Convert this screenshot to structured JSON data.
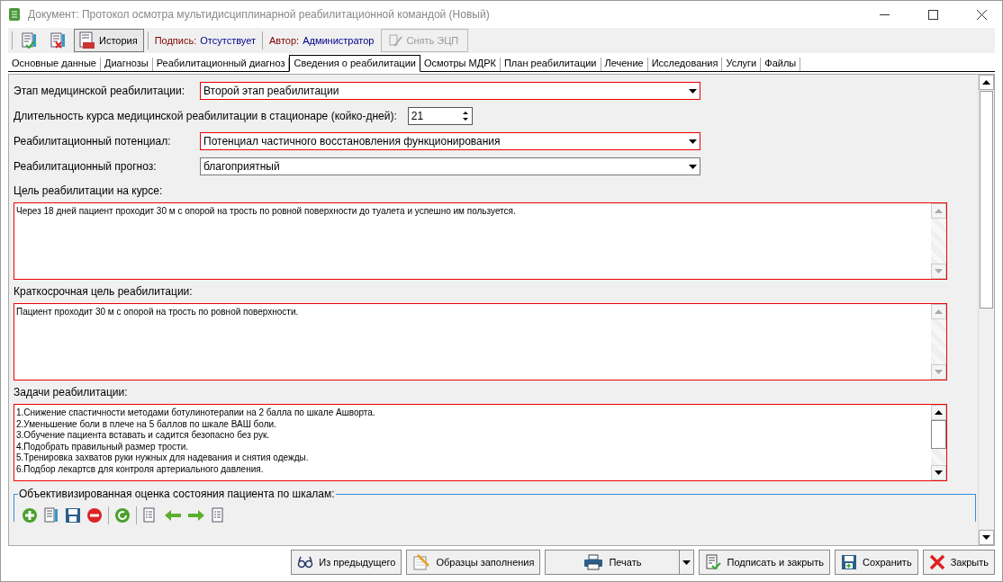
{
  "window": {
    "title": "Документ: Протокол осмотра мультидисциплинарной реабилитационной командой (Новый)"
  },
  "toolbar": {
    "history_button": "История",
    "signature_label": "Подпись:",
    "signature_value": "Отсутствует",
    "author_label": "Автор:",
    "author_value": "Администратор",
    "remove_signature": {
      "label": "Снять ЭЦП",
      "disabled": true
    }
  },
  "tabs": [
    {
      "label": "Основные данные",
      "selected": false
    },
    {
      "label": "Диагнозы",
      "selected": false
    },
    {
      "label": "Реабилитационный диагноз",
      "selected": false
    },
    {
      "label": "Сведения о реабилитации",
      "selected": true
    },
    {
      "label": "Осмотры МДРК",
      "selected": false
    },
    {
      "label": "План реабилитации",
      "selected": false
    },
    {
      "label": "Лечение",
      "selected": false
    },
    {
      "label": "Исследования",
      "selected": false
    },
    {
      "label": "Услуги",
      "selected": false
    },
    {
      "label": "Файлы",
      "selected": false
    }
  ],
  "fields": [
    {
      "kind": "combo",
      "label": "Этап медицинской реабилитации:",
      "value": "Второй этап реабилитации",
      "invalid": true
    },
    {
      "kind": "spin",
      "label": "Длительность курса медицинской реабилитации в стационаре (койко-дней):",
      "value": "21",
      "invalid": false
    },
    {
      "kind": "combo",
      "label": "Реабилитационный потенциал:",
      "value": "Потенциал частичного восстановления функционирования",
      "invalid": true
    },
    {
      "kind": "combo",
      "label": "Реабилитационный прогноз:",
      "value": "благоприятный",
      "invalid": false
    }
  ],
  "text_areas": [
    {
      "label": "Цель реабилитации на курсе:",
      "lines": [
        "Через 18 дней пациент проходит 30 м с опорой на трость по ровной поверхности до туалета и успешно им пользуется."
      ],
      "invalid": true,
      "scroll_enabled": false
    },
    {
      "label": "Краткосрочная цель реабилитации:",
      "lines": [
        "Пациент проходит 30 м с опорой на трость по ровной поверхности."
      ],
      "invalid": true,
      "scroll_enabled": false
    },
    {
      "label": "Задачи реабилитации:",
      "lines": [
        "1.Снижение спастичности методами ботулинотерапии на 2 балла по шкале Ашворта.",
        "2.Уменьшение боли в плече на 5 баллов по шкале ВАШ боли.",
        "3.Обучение пациента вставать и садится безопасно без рук.",
        "4.Подобрать правильный размер трости.",
        "5.Тренировка захватов руки нужных для надевания и снятия одежды.",
        "6.Подбор лекартсв для контроля артериального давления."
      ],
      "invalid": true,
      "scroll_enabled": true
    }
  ],
  "scales_group": {
    "title": "Объективизированная оценка состояния пациента по шкалам:"
  },
  "footer_buttons": [
    {
      "kind": "from-previous",
      "label": "Из предыдущего"
    },
    {
      "kind": "templates",
      "label": "Образцы заполнения"
    },
    {
      "kind": "print",
      "label": "Печать"
    },
    {
      "kind": "sign-close",
      "label": "Подписать и закрыть"
    },
    {
      "kind": "save",
      "label": "Сохранить"
    },
    {
      "kind": "close",
      "label": "Закрыть"
    }
  ]
}
